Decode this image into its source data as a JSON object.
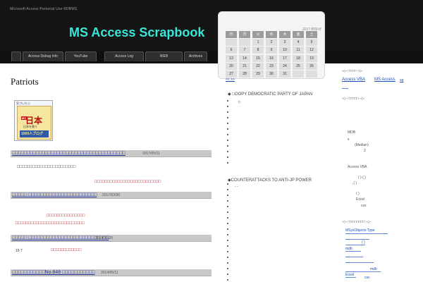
{
  "header": {
    "tagline": "Microsoft Access   Personal Use   RDBMS",
    "site_title": "MS Access Scrapbook",
    "nav": [
      "Access Debug Info",
      "YouTube",
      "Access Log",
      "WEB",
      "Archives"
    ]
  },
  "main": {
    "page_title": "Patriots",
    "banner": {
      "top": "気づいたら",
      "my": "MY",
      "nihon": "日本",
      "mid": "日本を救う",
      "bottom": "1000人ブログ"
    },
    "posts": [
      {
        "title": "□□□□□□□□□□□□□□□□□□□□□□□□□□□□□□□□□□□□□□",
        "date": "2017/05/11",
        "lines": [
          "□□□□□□□□□□□□□□□□□□□□□□□"
        ],
        "red": [
          "□□□□□□□□□□□□□□□□□□□□□□□□□□"
        ]
      },
      {
        "title": "□□□□□ □□□□□□□□□□□□□□□□□□□□□□□",
        "date": "2017/03/30",
        "lines": [],
        "red": [
          "□□□□□□□□□□□□□□□",
          "□□□□□□□□□□□□□□□□□□□□□□□□□□□"
        ]
      },
      {
        "title": "□□□□□ □□□□□□□□□□□□□□□□□□□□□□□□□□□",
        "date": "2014/10/20",
        "lines": [
          "19 7"
        ],
        "red": [
          "□□□□□□□□□□□□"
        ]
      },
      {
        "title": "□□□□□□□□□□□No.848 □□□□□□□□□□□",
        "date": "2014/05/11",
        "lines": [],
        "red": []
      }
    ]
  },
  "calendar": {
    "title": "2017年08月",
    "weekdays": [
      "日",
      "月",
      "火",
      "水",
      "木",
      "金",
      "土"
    ],
    "days": [
      "",
      "",
      "1",
      "2",
      "3",
      "4",
      "5",
      "6",
      "7",
      "8",
      "9",
      "10",
      "11",
      "12",
      "13",
      "14",
      "15",
      "16",
      "17",
      "18",
      "19",
      "20",
      "21",
      "22",
      "23",
      "24",
      "25",
      "26",
      "27",
      "28",
      "29",
      "30",
      "31",
      "",
      ""
    ],
    "nav": "<<  >>"
  },
  "middle": {
    "section1": "◆ □OOPY DEMOCRATIC PARTY OF JAPAN",
    "section1_note": "!!",
    "section2": "◆COUNTERATTACKS TO ANTI-JP POWER",
    "section2_note": "- -",
    "dot_count": 32
  },
  "sidebar": {
    "head1": "-◇- □□□□ -◇-",
    "links1": [
      "Access VBA",
      "MS Access",
      "sq"
    ],
    "head2": "-◇- □□□□□ -◇-",
    "notes": [
      "MDB",
      "s",
      "(Median)",
      "2",
      "Access VBA",
      "(   )   (   )",
      ",(   )",
      "(   )",
      "Excel",
      "csv"
    ],
    "head3": "-◇- □□□□□□□□ -◇-",
    "list": [
      "MSysObjects     Type",
      "",
      "(   )",
      "mdb",
      "",
      "",
      "mdb",
      "Excel",
      "csv"
    ]
  }
}
